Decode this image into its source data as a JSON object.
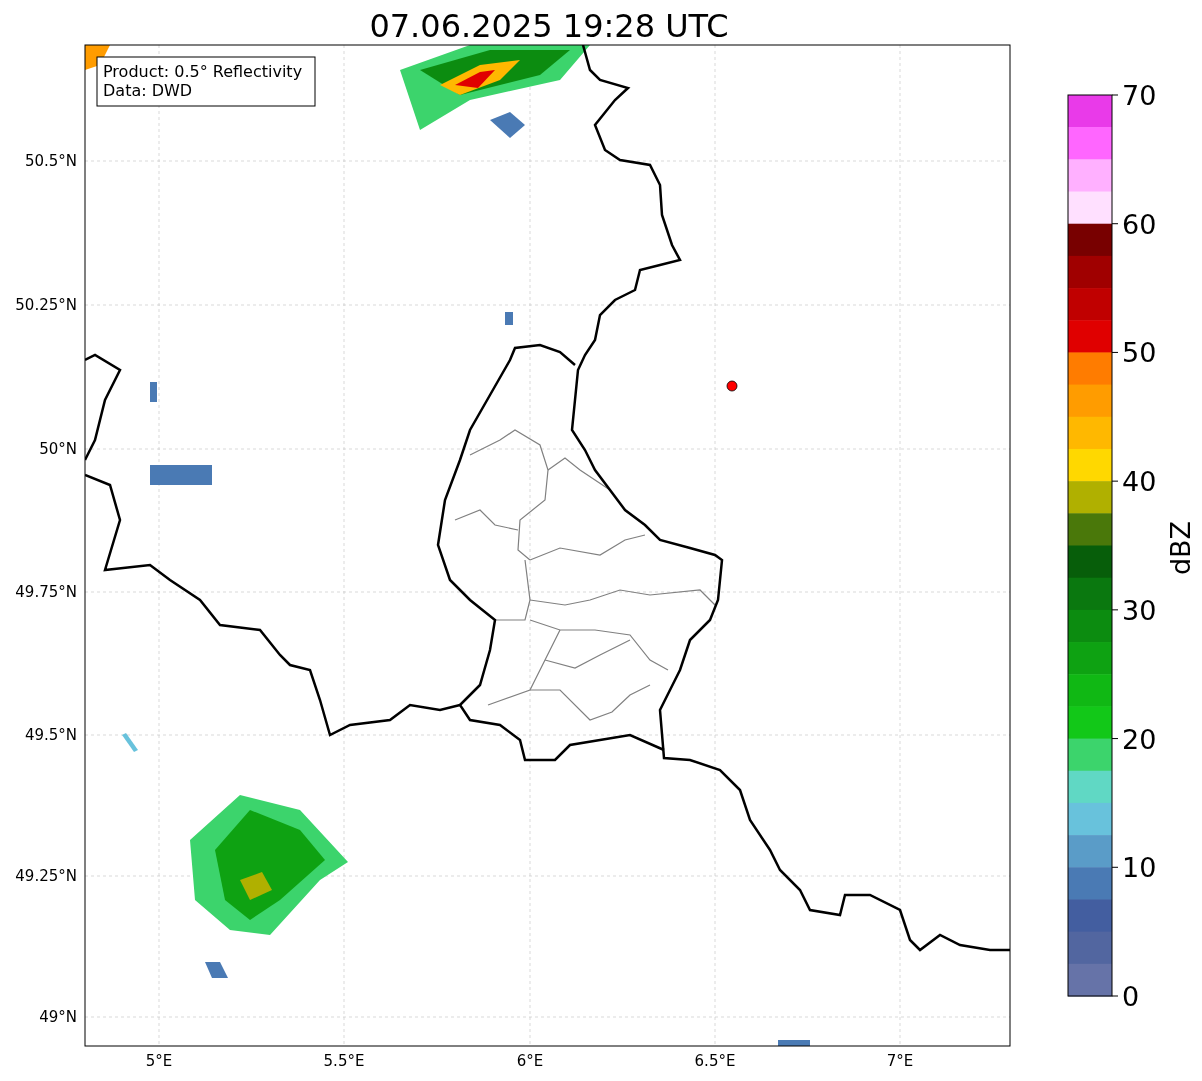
{
  "title": "07.06.2025 19:28 UTC",
  "info_box": {
    "lines": [
      "Product: 0.5° Reflectivity",
      "Data: DWD"
    ]
  },
  "y_axis": {
    "ticks": [
      "50.5°N",
      "50.25°N",
      "50°N",
      "49.75°N",
      "49.5°N",
      "49.25°N",
      "49°N"
    ]
  },
  "x_axis": {
    "ticks": [
      "5°E",
      "5.5°E",
      "6°E",
      "6.5°E",
      "7°E"
    ]
  },
  "colorbar": {
    "label": "dBZ",
    "ticks": [
      "70",
      "60",
      "50",
      "40",
      "30",
      "20",
      "10",
      "0"
    ],
    "segments": [
      {
        "color": "#e93ae9"
      },
      {
        "color": "#ff66ff"
      },
      {
        "color": "#ffb0ff"
      },
      {
        "color": "#ffe0ff"
      },
      {
        "color": "#780000"
      },
      {
        "color": "#a00000"
      },
      {
        "color": "#c00000"
      },
      {
        "color": "#e00000"
      },
      {
        "color": "#ff7c00"
      },
      {
        "color": "#ff9c00"
      },
      {
        "color": "#ffb800"
      },
      {
        "color": "#ffd800"
      },
      {
        "color": "#b0b000"
      },
      {
        "color": "#4a780a"
      },
      {
        "color": "#075e0a"
      },
      {
        "color": "#0a780f"
      },
      {
        "color": "#0c8c10"
      },
      {
        "color": "#0ea212"
      },
      {
        "color": "#10b814"
      },
      {
        "color": "#12c818"
      },
      {
        "color": "#3cd46c"
      },
      {
        "color": "#60d8c4"
      },
      {
        "color": "#68c2dc"
      },
      {
        "color": "#5a9cc8"
      },
      {
        "color": "#4a7ab4"
      },
      {
        "color": "#435ea0"
      },
      {
        "color": "#5266a0"
      },
      {
        "color": "#6673a8"
      }
    ]
  }
}
